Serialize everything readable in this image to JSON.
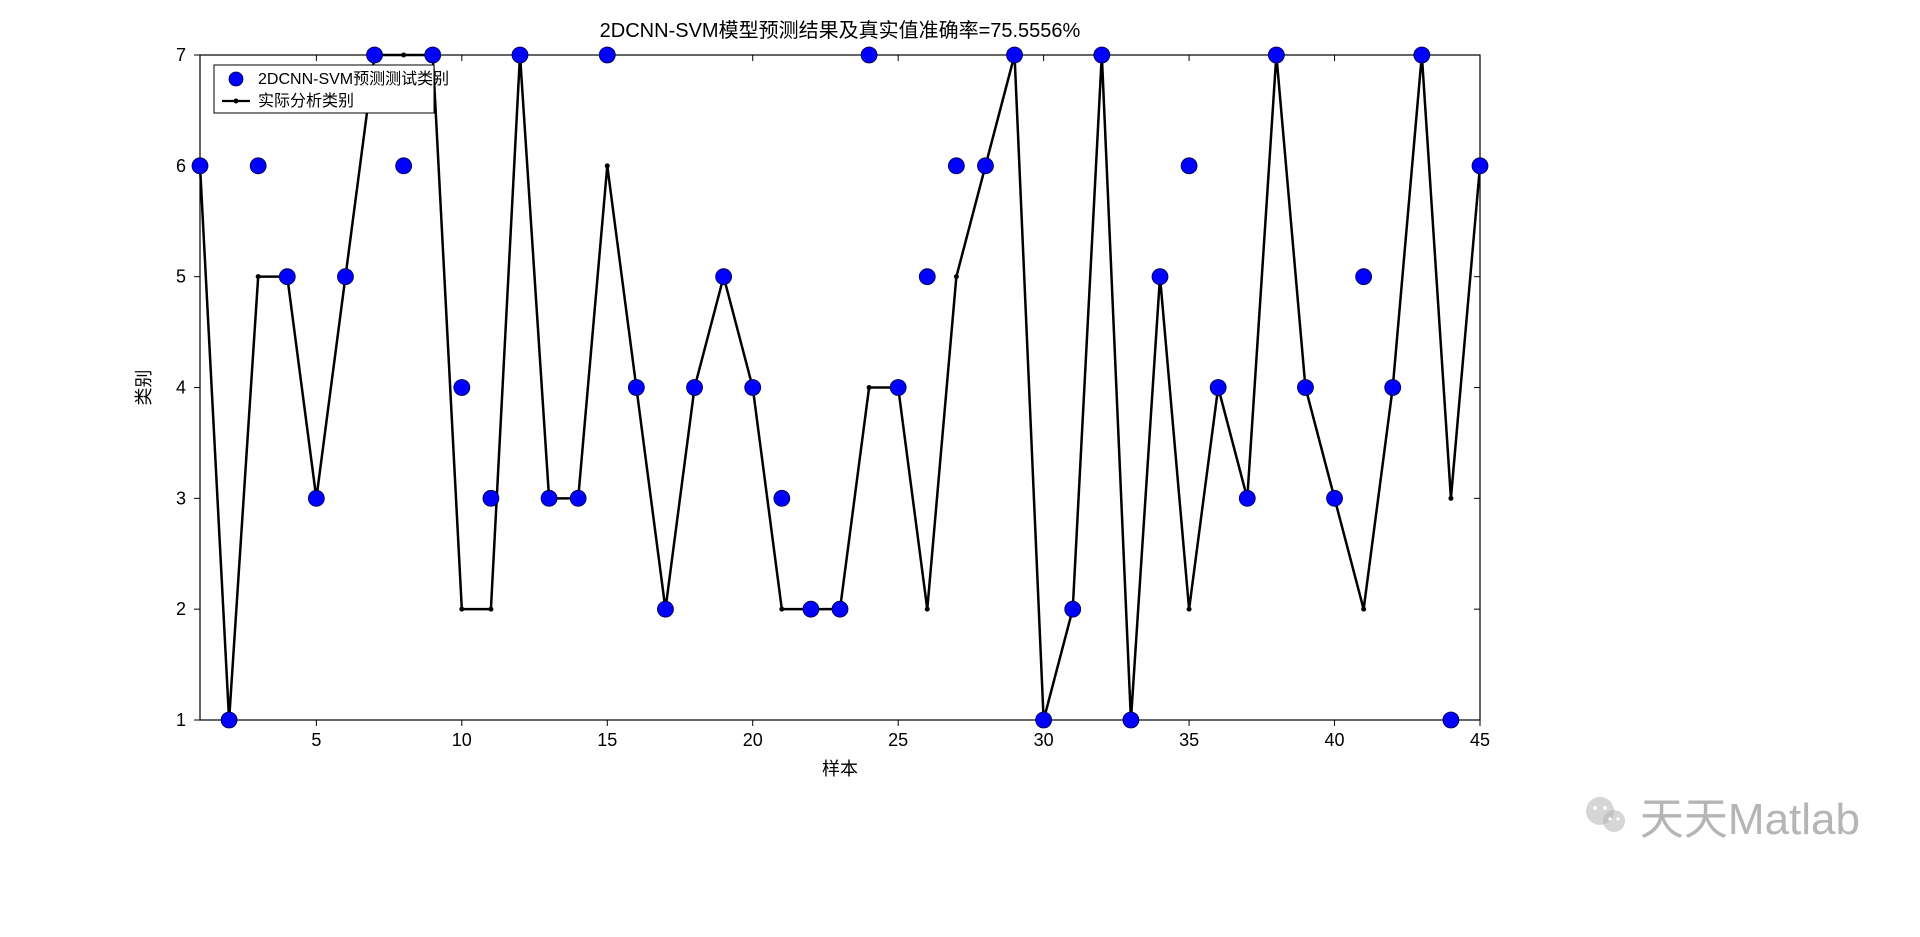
{
  "chart_data": {
    "type": "line",
    "title": "2DCNN-SVM模型预测结果及真实值准确率=75.5556%",
    "xlabel": "样本",
    "ylabel": "类别",
    "xlim": [
      1,
      45
    ],
    "ylim": [
      1,
      7
    ],
    "xticks": [
      5,
      10,
      15,
      20,
      25,
      30,
      35,
      40,
      45
    ],
    "yticks": [
      1,
      2,
      3,
      4,
      5,
      6,
      7
    ],
    "x": [
      1,
      2,
      3,
      4,
      5,
      6,
      7,
      8,
      9,
      10,
      11,
      12,
      13,
      14,
      15,
      16,
      17,
      18,
      19,
      20,
      21,
      22,
      23,
      24,
      25,
      26,
      27,
      28,
      29,
      30,
      31,
      32,
      33,
      34,
      35,
      36,
      37,
      38,
      39,
      40,
      41,
      42,
      43,
      44,
      45
    ],
    "series": [
      {
        "name": "2DCNN-SVM预测测试类别",
        "type": "scatter",
        "color": "#0000ff",
        "values": [
          6,
          1,
          6,
          5,
          3,
          5,
          7,
          6,
          7,
          4,
          3,
          7,
          3,
          3,
          7,
          4,
          2,
          4,
          5,
          4,
          3,
          2,
          2,
          7,
          4,
          5,
          6,
          6,
          7,
          1,
          2,
          7,
          1,
          5,
          6,
          4,
          3,
          7,
          4,
          3,
          5,
          4,
          7,
          1,
          6
        ]
      },
      {
        "name": "实际分析类别",
        "type": "line",
        "color": "#000000",
        "values": [
          6,
          1,
          5,
          5,
          3,
          5,
          7,
          7,
          7,
          2,
          2,
          7,
          3,
          3,
          6,
          4,
          2,
          4,
          5,
          4,
          2,
          2,
          2,
          4,
          4,
          2,
          5,
          6,
          7,
          1,
          2,
          7,
          1,
          5,
          2,
          4,
          3,
          7,
          4,
          3,
          2,
          4,
          7,
          3,
          6
        ]
      }
    ],
    "legend": {
      "items": [
        "2DCNN-SVM预测测试类别",
        "实际分析类别"
      ]
    }
  },
  "watermark": "天天Matlab"
}
